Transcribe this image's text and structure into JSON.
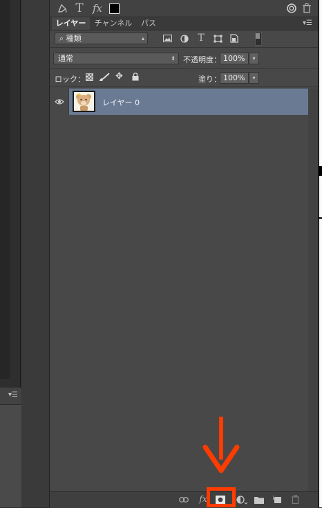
{
  "tool_strip": {
    "icons": [
      "paint-bucket-icon",
      "type-icon",
      "fx-icon",
      "color-swatch-icon",
      "creative-cloud-icon",
      "trash-icon"
    ]
  },
  "tabs": [
    {
      "label": "レイヤー",
      "active": true
    },
    {
      "label": "チャンネル",
      "active": false
    },
    {
      "label": "パス",
      "active": false
    }
  ],
  "filter": {
    "kind_label": "種類"
  },
  "blend": {
    "mode": "通常",
    "opacity_label": "不透明度：",
    "opacity_value": "100%"
  },
  "lock": {
    "label": "ロック：",
    "fill_label": "塗り：",
    "fill_value": "100%"
  },
  "layers": [
    {
      "name": "レイヤー 0",
      "visible": true,
      "selected": true
    }
  ],
  "bottom_toolbar": {
    "buttons": [
      "link-layers-icon",
      "fx-icon",
      "add-mask-icon",
      "adjustment-layer-icon",
      "new-group-icon",
      "new-layer-icon",
      "delete-layer-icon"
    ],
    "highlighted": "add-mask-icon"
  },
  "colors": {
    "panel_bg": "#484848",
    "selected_row": "#6a7a93",
    "annotation": "#ff3c00"
  }
}
